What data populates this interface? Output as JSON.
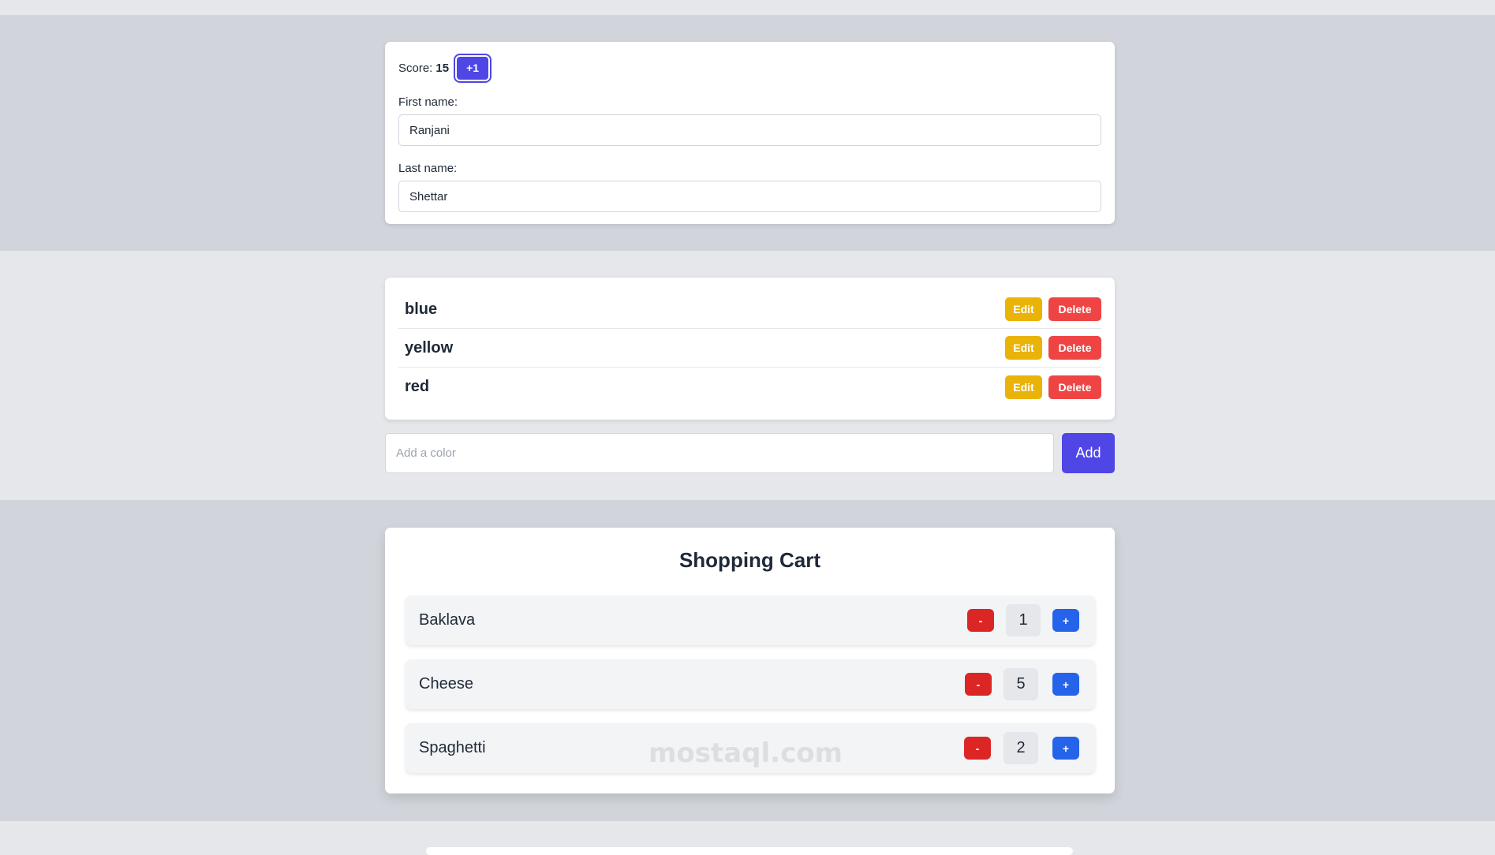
{
  "profile": {
    "score_label": "Score:",
    "score_value": "15",
    "increment_label": "+1",
    "first_name_label": "First name:",
    "first_name_value": "Ranjani",
    "last_name_label": "Last name:",
    "last_name_value": "Shettar"
  },
  "colors": {
    "items": [
      {
        "name": "blue",
        "edit_label": "Edit",
        "delete_label": "Delete"
      },
      {
        "name": "yellow",
        "edit_label": "Edit",
        "delete_label": "Delete"
      },
      {
        "name": "red",
        "edit_label": "Edit",
        "delete_label": "Delete"
      }
    ],
    "input_placeholder": "Add a color",
    "add_label": "Add"
  },
  "cart": {
    "title": "Shopping Cart",
    "items": [
      {
        "name": "Baklava",
        "minus_label": "-",
        "quantity": "1",
        "plus_label": "+"
      },
      {
        "name": "Cheese",
        "minus_label": "-",
        "quantity": "5",
        "plus_label": "+"
      },
      {
        "name": "Spaghetti",
        "minus_label": "-",
        "quantity": "2",
        "plus_label": "+"
      }
    ]
  },
  "watermark": "mostaql.com",
  "theme": {
    "primary": "#4f46e5",
    "edit": "#eab308",
    "delete": "#ef4444",
    "minus": "#dc2626",
    "plus": "#2563eb"
  }
}
